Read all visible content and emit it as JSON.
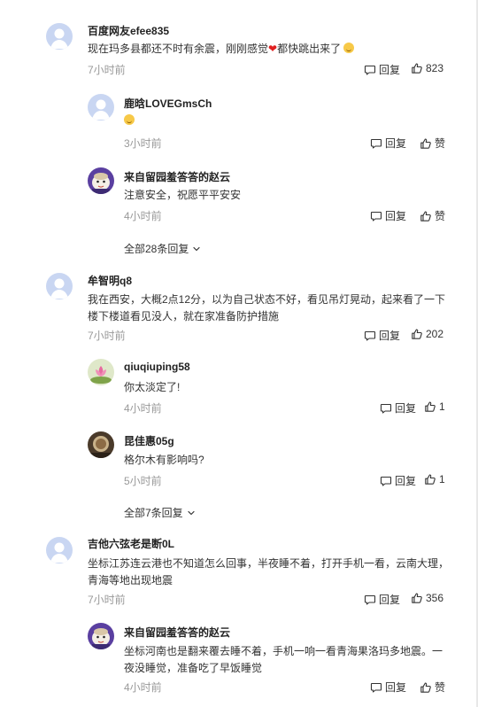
{
  "labels": {
    "reply": "回复",
    "like": "赞"
  },
  "threads": [
    {
      "user": "百度网友efee835",
      "text_a": "现在玛多县都还不时有余震，刚刚感觉",
      "text_b": "都快跳出来了",
      "time": "7小时前",
      "likes": "823",
      "replies": [
        {
          "user": "鹿晗LOVEGmsCh",
          "text": "",
          "time": "3小时前",
          "likes": "赞"
        },
        {
          "user": "来自留园羞答答的赵云",
          "text": "注意安全，祝愿平平安安",
          "time": "4小时前",
          "likes": "赞"
        }
      ],
      "more": "全部28条回复"
    },
    {
      "user": "牟智明q8",
      "text": "我在西安，大概2点12分，以为自己状态不好，看见吊灯晃动，起来看了一下楼下楼道看见没人，就在家准备防护措施",
      "time": "7小时前",
      "likes": "202",
      "replies": [
        {
          "user": "qiuqiuping58",
          "text": "你太淡定了!",
          "time": "4小时前",
          "likes": "1"
        },
        {
          "user": "昆佳惠05g",
          "text": "格尔木有影响吗?",
          "time": "5小时前",
          "likes": "1"
        }
      ],
      "more": "全部7条回复"
    },
    {
      "user": "吉他六弦老是断0L",
      "text": "坐标江苏连云港也不知道怎么回事，半夜睡不着，打开手机一看，云南大理，青海等地出现地震",
      "time": "7小时前",
      "likes": "356",
      "replies": [
        {
          "user": "来自留园羞答答的赵云",
          "text": "坐标河南也是翻来覆去睡不着，手机一响一看青海果洛玛多地震。一夜没睡觉，准备吃了早饭睡觉",
          "time": "4小时前",
          "likes": "赞"
        }
      ]
    }
  ],
  "colors": {
    "text_muted": "#999999",
    "heart": "#e02020",
    "avatar_default": "#c9d6f2"
  }
}
